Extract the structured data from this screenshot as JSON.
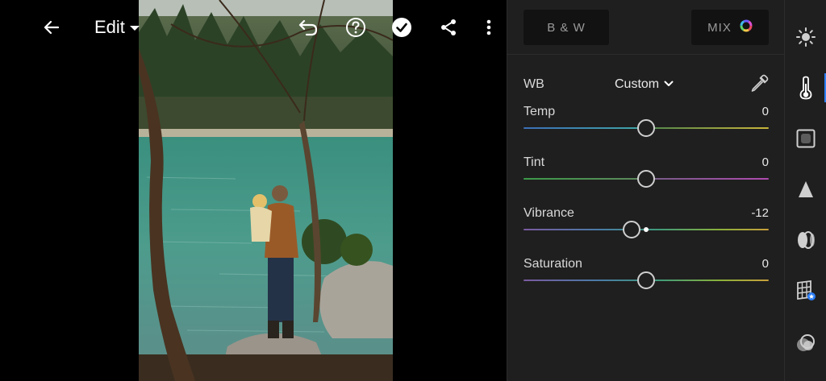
{
  "topbar": {
    "title": "Edit",
    "icons": [
      "back-arrow-icon",
      "undo-icon",
      "help-icon",
      "checkmark-icon",
      "share-icon",
      "more-vertical-icon"
    ]
  },
  "panel": {
    "tabs": {
      "bw_label": "B & W",
      "mix_label": "MIX"
    },
    "wb": {
      "label": "WB",
      "mode": "Custom"
    },
    "sliders": [
      {
        "name": "Temp",
        "value": "0",
        "position": 0.5
      },
      {
        "name": "Tint",
        "value": "0",
        "position": 0.5
      },
      {
        "name": "Vibrance",
        "value": "-12",
        "position": 0.44
      },
      {
        "name": "Saturation",
        "value": "0",
        "position": 0.5
      }
    ]
  },
  "toolstrip": {
    "items": [
      "light-icon",
      "color-temperature-icon",
      "effects-icon",
      "detail-icon",
      "optics-icon",
      "geometry-icon",
      "presets-icon"
    ],
    "active": "color-temperature-icon"
  },
  "colors": {
    "accent": "#2d7ff9",
    "panel_bg": "#1f1f1f",
    "tab_bg": "#121212"
  }
}
